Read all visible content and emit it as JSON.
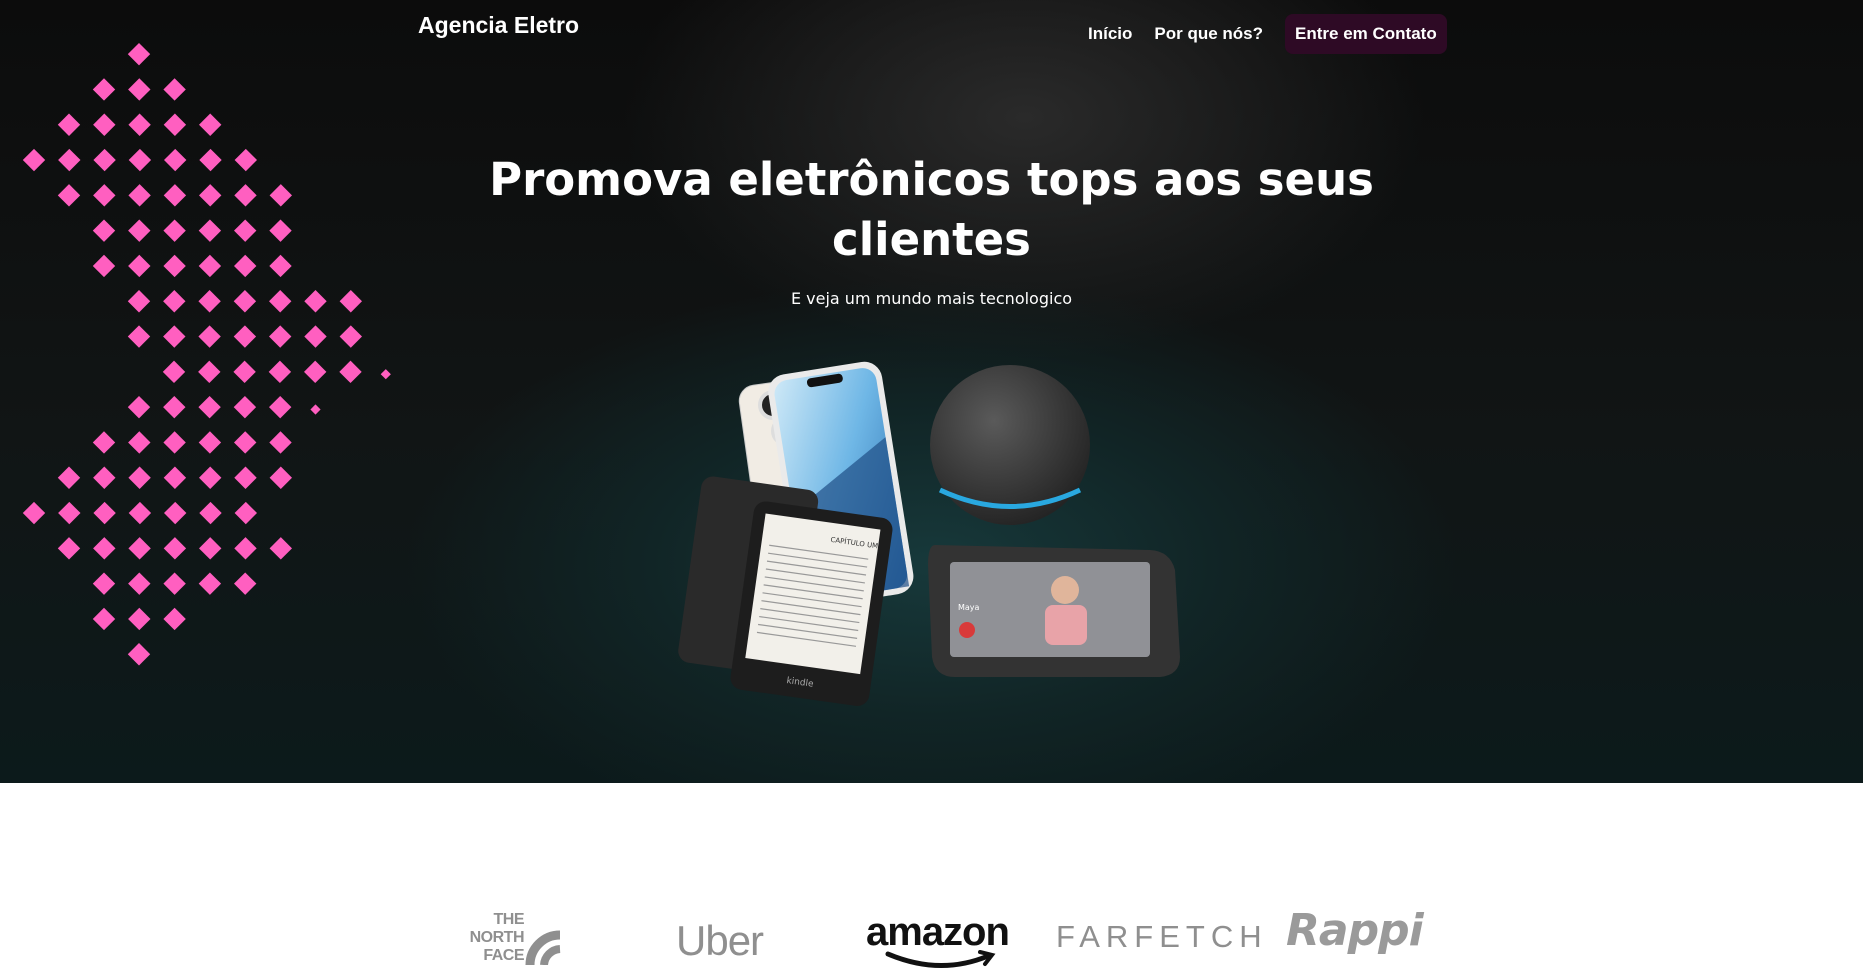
{
  "header": {
    "logo": "Agencia Eletro",
    "nav": {
      "home": "Início",
      "why": "Por que nós?",
      "contact": "Entre em Contato"
    }
  },
  "hero": {
    "title_line1": "Promova eletrônicos tops aos seus",
    "title_line2": "clientes",
    "subtitle": "E veja um mundo mais tecnologico"
  },
  "devices_screen": {
    "kindle_brand": "kindle",
    "kindle_chapter": "CAPÍTULO UM",
    "echo_caller": "Maya"
  },
  "brands": {
    "north_face": "THE NORTH FACE",
    "uber": "Uber",
    "amazon": "amazon",
    "farfetch": "FARFETCH",
    "rappi": "Rappi"
  },
  "colors": {
    "accent_pink": "#ff5fc0",
    "cta_bg": "#2e0a25",
    "brand_gray": "#8f8f8f"
  }
}
